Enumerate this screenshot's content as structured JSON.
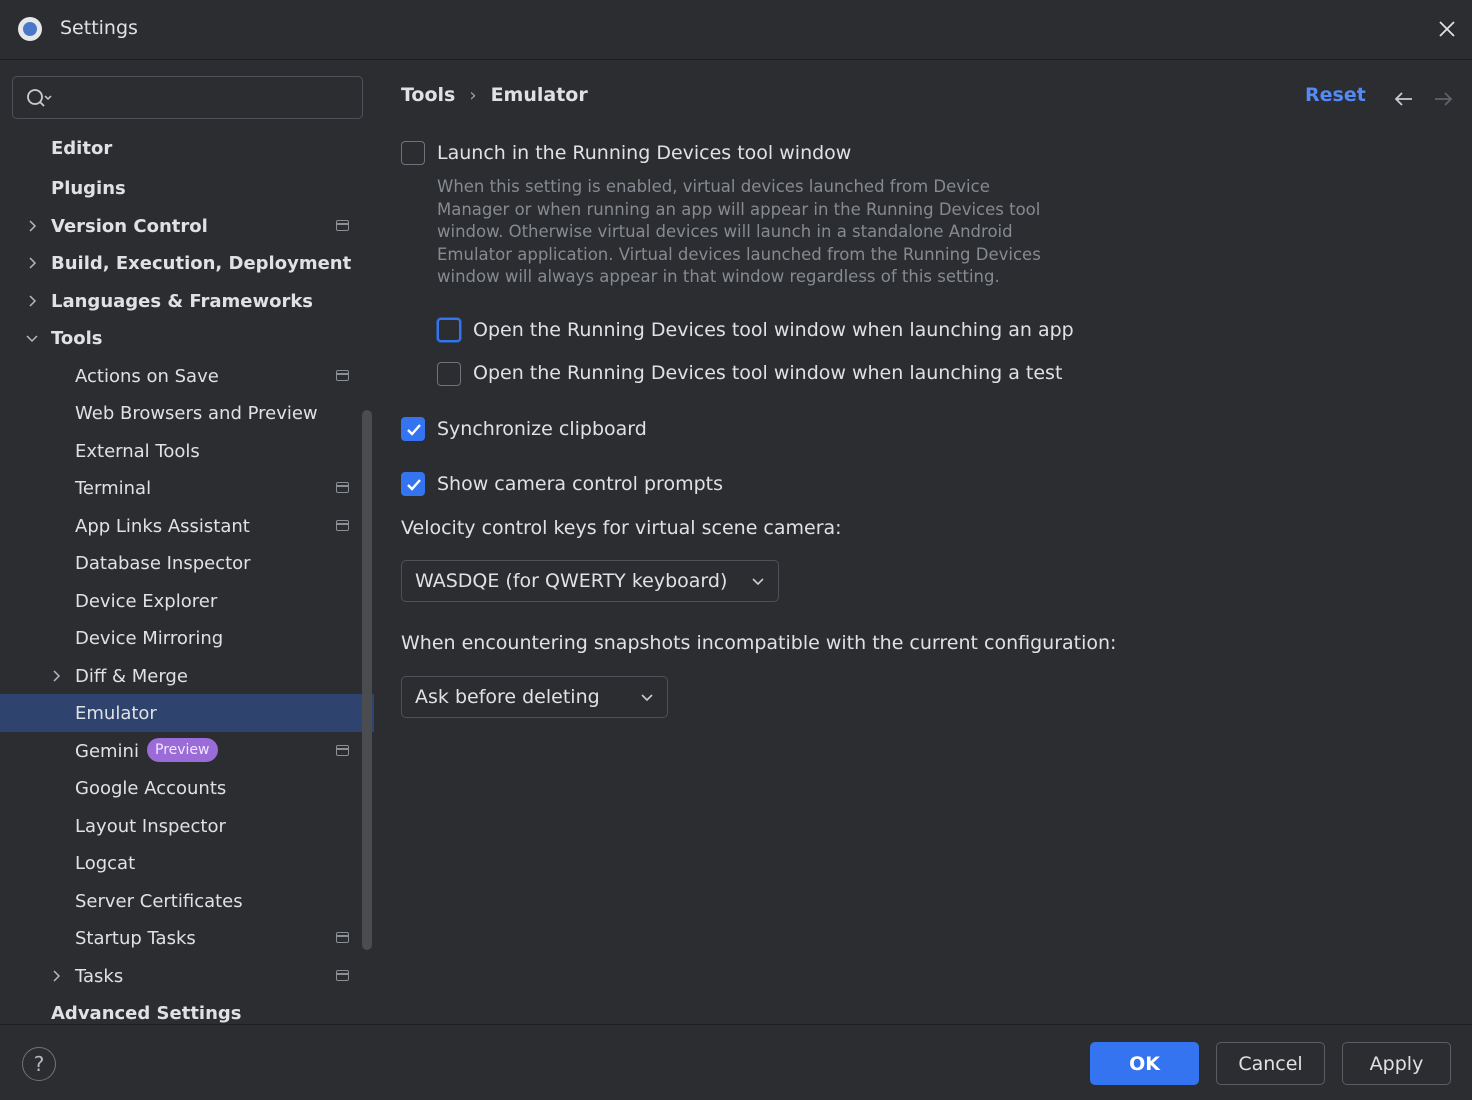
{
  "window": {
    "title": "Settings"
  },
  "search": {
    "placeholder": "",
    "value": ""
  },
  "sidebar": {
    "items": [
      {
        "label": "Editor",
        "level": 1,
        "bold": true,
        "expandable": false
      },
      {
        "label": "Plugins",
        "level": 1,
        "bold": true,
        "expandable": false
      },
      {
        "label": "Version Control",
        "level": 1,
        "bold": true,
        "expandable": true,
        "project_icon": true
      },
      {
        "label": "Build, Execution, Deployment",
        "level": 1,
        "bold": true,
        "expandable": true
      },
      {
        "label": "Languages & Frameworks",
        "level": 1,
        "bold": true,
        "expandable": true
      },
      {
        "label": "Tools",
        "level": 1,
        "bold": true,
        "expandable": true,
        "expanded": true
      },
      {
        "label": "Actions on Save",
        "level": 2,
        "project_icon": true
      },
      {
        "label": "Web Browsers and Preview",
        "level": 2
      },
      {
        "label": "External Tools",
        "level": 2
      },
      {
        "label": "Terminal",
        "level": 2,
        "project_icon": true
      },
      {
        "label": "App Links Assistant",
        "level": 2,
        "project_icon": true
      },
      {
        "label": "Database Inspector",
        "level": 2
      },
      {
        "label": "Device Explorer",
        "level": 2
      },
      {
        "label": "Device Mirroring",
        "level": 2
      },
      {
        "label": "Diff & Merge",
        "level": 2,
        "expandable": true
      },
      {
        "label": "Emulator",
        "level": 2,
        "selected": true
      },
      {
        "label": "Gemini",
        "level": 2,
        "badge": "Preview",
        "project_icon": true
      },
      {
        "label": "Google Accounts",
        "level": 2
      },
      {
        "label": "Layout Inspector",
        "level": 2
      },
      {
        "label": "Logcat",
        "level": 2
      },
      {
        "label": "Server Certificates",
        "level": 2
      },
      {
        "label": "Startup Tasks",
        "level": 2,
        "project_icon": true
      },
      {
        "label": "Tasks",
        "level": 2,
        "expandable": true,
        "project_icon": true
      },
      {
        "label": "Advanced Settings",
        "level": 1,
        "bold": true
      }
    ]
  },
  "breadcrumb": {
    "parent": "Tools",
    "separator": "›",
    "current": "Emulator"
  },
  "header": {
    "reset_label": "Reset"
  },
  "content": {
    "launch_in_running_devices": {
      "label": "Launch in the Running Devices tool window",
      "checked": false,
      "description": "When this setting is enabled, virtual devices launched from Device Manager or when running an app will appear in the Running Devices tool window. Otherwise virtual devices will launch in a standalone Android Emulator application. Virtual devices launched from the Running Devices window will always appear in that window regardless of this setting."
    },
    "open_on_app": {
      "label": "Open the Running Devices tool window when launching an app",
      "checked": false
    },
    "open_on_test": {
      "label": "Open the Running Devices tool window when launching a test",
      "checked": false
    },
    "sync_clipboard": {
      "label": "Synchronize clipboard",
      "checked": true
    },
    "camera_prompts": {
      "label": "Show camera control prompts",
      "checked": true
    },
    "velocity_keys": {
      "label": "Velocity control keys for virtual scene camera:",
      "selected": "WASDQE (for QWERTY keyboard)"
    },
    "snapshots": {
      "label": "When encountering snapshots incompatible with the current configuration:",
      "selected": "Ask before deleting"
    }
  },
  "footer": {
    "help_label": "?",
    "ok_label": "OK",
    "cancel_label": "Cancel",
    "apply_label": "Apply"
  },
  "colors": {
    "background": "#2b2d30",
    "accent": "#3574f0",
    "link": "#548af7",
    "selection": "#2e436e",
    "badge": "#9b6cd8"
  }
}
